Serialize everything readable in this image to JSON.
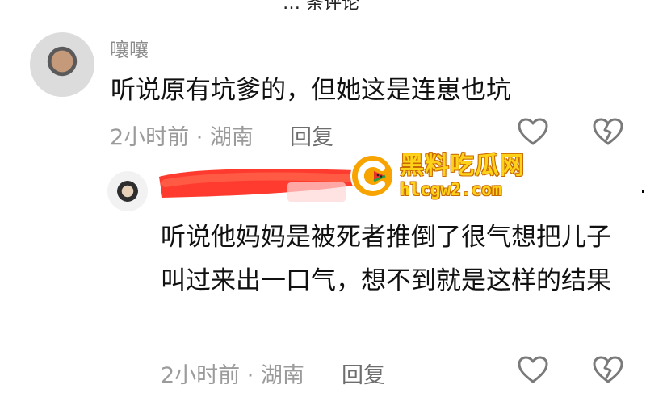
{
  "header": {
    "cut_text": "… 条评论"
  },
  "comment_1": {
    "username": "嚷嚷",
    "text": "听说原有坑爹的，但她这是连崽也坑",
    "meta": "2小时前 · 湖南",
    "reply_label": "回复"
  },
  "comment_2": {
    "text": "听说他妈妈是被死者推倒了很气想把儿子叫过来出一口气，想不到就是这样的结果",
    "meta": "2小时前 · 湖南",
    "reply_label": "回复"
  },
  "watermark": {
    "title": "黑料吃瓜网",
    "url": "hlcgw2.com"
  },
  "icons": {
    "like": "heart-outline-icon",
    "dislike": "broken-heart-icon"
  },
  "colors": {
    "redaction": "#ff3b2f",
    "watermark_yellow": "#ffd21a",
    "watermark_orange": "#f08c00",
    "muted_text": "#9b9b9b"
  }
}
